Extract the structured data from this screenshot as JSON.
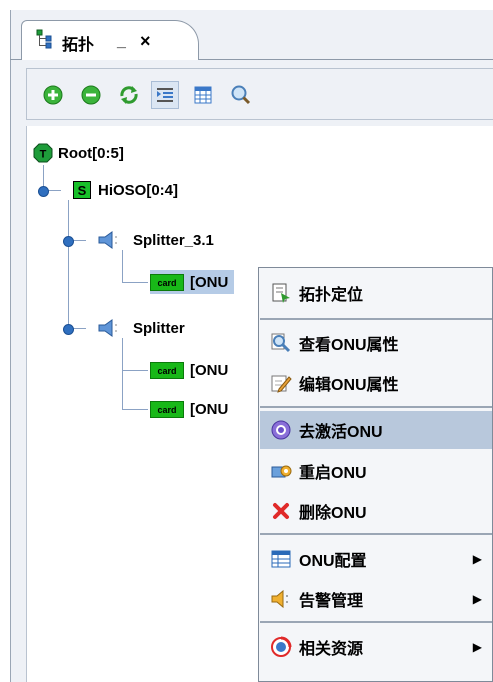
{
  "tab": {
    "title": "拓扑",
    "minimize": "_",
    "close": "×"
  },
  "toolbar": [
    "add-icon",
    "remove-icon",
    "refresh-icon",
    "indent-icon",
    "table-icon",
    "search-icon"
  ],
  "tree": {
    "root": "Root[0:5]",
    "olt": "HiOSO[0:4]",
    "splitter1": "Splitter_3.1",
    "splitter2": "Splitter",
    "onu_label": "[ONU",
    "card_text": "card"
  },
  "menu": {
    "items": [
      {
        "label": "拓扑定位",
        "icon": "locate-icon"
      },
      {
        "label": "查看ONU属性",
        "icon": "view-props-icon"
      },
      {
        "label": "编辑ONU属性",
        "icon": "edit-props-icon"
      },
      {
        "label": "去激活ONU",
        "icon": "deactivate-icon",
        "highlighted": true
      },
      {
        "label": "重启ONU",
        "icon": "restart-icon"
      },
      {
        "label": "删除ONU",
        "icon": "delete-icon"
      },
      {
        "label": "ONU配置",
        "icon": "config-icon",
        "submenu": "▶"
      },
      {
        "label": "告警管理",
        "icon": "alarm-icon",
        "submenu": "▶"
      },
      {
        "label": "相关资源",
        "icon": "resource-icon",
        "submenu": "▶"
      }
    ]
  },
  "colors": {
    "highlight": "#b8c8dc",
    "selected": "#b5cbe6",
    "card": "#18b818"
  }
}
